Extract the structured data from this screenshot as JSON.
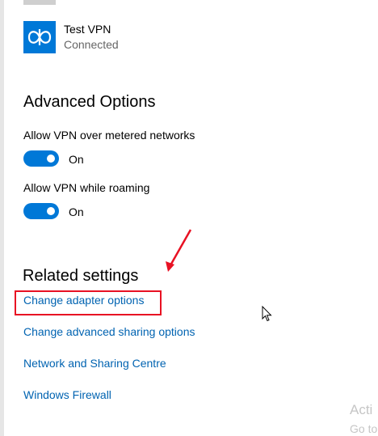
{
  "vpn": {
    "name": "Test VPN",
    "status": "Connected",
    "icon": "vpn-icon"
  },
  "advanced_options": {
    "title": "Advanced Options",
    "settings": [
      {
        "label": "Allow VPN over metered networks",
        "toggle_state": "On",
        "enabled": true
      },
      {
        "label": "Allow VPN while roaming",
        "toggle_state": "On",
        "enabled": true
      }
    ]
  },
  "related_settings": {
    "title": "Related settings",
    "links": [
      "Change adapter options",
      "Change advanced sharing options",
      "Network and Sharing Centre",
      "Windows Firewall"
    ]
  },
  "watermark": {
    "line1": "Acti",
    "line2": "Go to"
  },
  "colors": {
    "accent": "#0078d7",
    "link": "#0063b1",
    "annotation": "#e81123",
    "secondary_text": "#666666"
  }
}
